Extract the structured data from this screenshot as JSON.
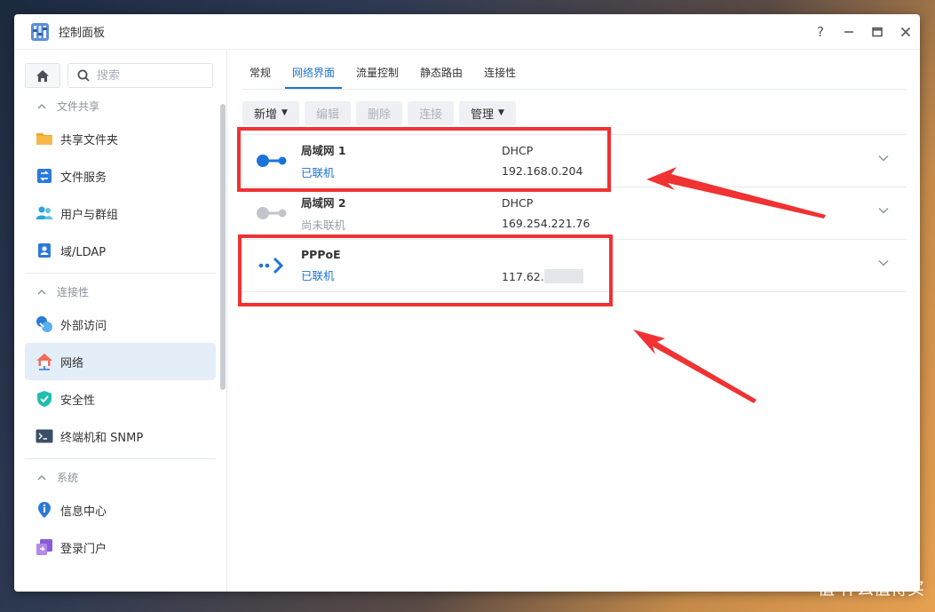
{
  "window": {
    "title": "控制面板"
  },
  "controls": {
    "help": "?"
  },
  "sidebar": {
    "search_placeholder": "搜索",
    "sections": [
      {
        "label": "文件共享",
        "items": [
          {
            "label": "共享文件夹",
            "icon": "folder-icon"
          },
          {
            "label": "文件服务",
            "icon": "file-services-icon"
          },
          {
            "label": "用户与群组",
            "icon": "users-icon"
          },
          {
            "label": "域/LDAP",
            "icon": "domain-icon"
          }
        ]
      },
      {
        "label": "连接性",
        "items": [
          {
            "label": "外部访问",
            "icon": "external-access-icon"
          },
          {
            "label": "网络",
            "icon": "network-house-icon",
            "active": true
          },
          {
            "label": "安全性",
            "icon": "shield-icon"
          },
          {
            "label": "终端机和 SNMP",
            "icon": "terminal-icon"
          }
        ]
      },
      {
        "label": "系统",
        "items": [
          {
            "label": "信息中心",
            "icon": "info-icon"
          },
          {
            "label": "登录门户",
            "icon": "login-portal-icon"
          }
        ]
      }
    ]
  },
  "tabs": [
    {
      "label": "常规"
    },
    {
      "label": "网络界面",
      "active": true
    },
    {
      "label": "流量控制"
    },
    {
      "label": "静态路由"
    },
    {
      "label": "连接性"
    }
  ],
  "toolbar": {
    "create": "新增",
    "edit": "编辑",
    "delete": "删除",
    "connect": "连接",
    "manage": "管理"
  },
  "interfaces": [
    {
      "name": "局域网 1",
      "status": "已联机",
      "mode": "DHCP",
      "ip": "192.168.0.204"
    },
    {
      "name": "局域网 2",
      "status": "尚未联机",
      "mode": "DHCP",
      "ip": "169.254.221.76"
    },
    {
      "name": "PPPoE",
      "status": "已联机",
      "mode": "",
      "ip": "117.62."
    }
  ],
  "watermark": "值 什么值得买",
  "colors": {
    "accent": "#1a73d9",
    "highlight": "#f03232"
  }
}
